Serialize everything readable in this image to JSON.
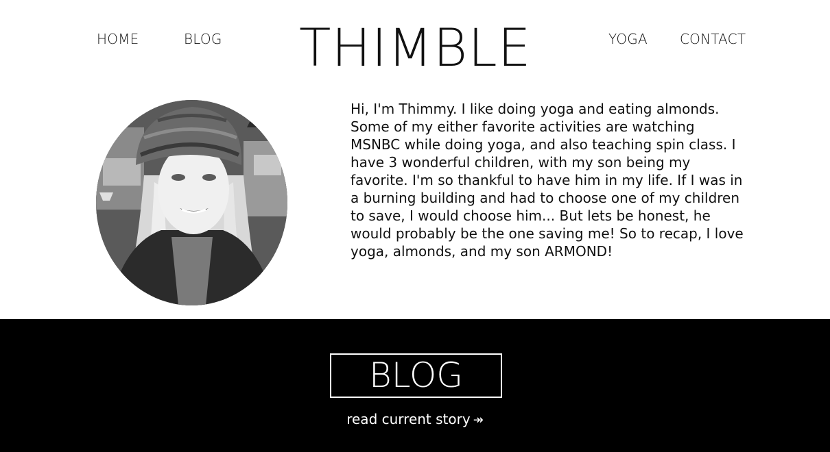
{
  "nav": {
    "home": "HOME",
    "blog": "BLOG",
    "yoga": "YOGA",
    "contact": "CONTACT"
  },
  "site_title": "THIMBLE",
  "about": {
    "bio": "Hi, I'm Thimmy. I like doing yoga and eating almonds. Some of my either favorite activities are watching MSNBC while doing yoga, and also teaching spin class. I have 3 wonderful children, with my son being my favorite. I'm so thankful to have him in my life. If I was in a burning building and had to choose one of my children to save, I would choose him... But lets be honest, he would probably be the one saving me! So to recap, I love yoga, almonds, and my son ARMOND!"
  },
  "blog_section": {
    "button_label": "BLOG",
    "read_link": "read current story",
    "read_arrow": "↠"
  },
  "colors": {
    "background": "#ffffff",
    "text": "#111111",
    "band": "#000000",
    "band_text": "#ffffff"
  }
}
